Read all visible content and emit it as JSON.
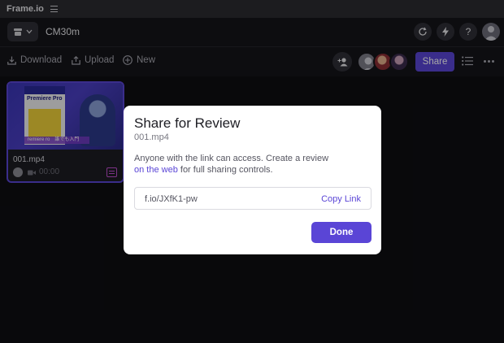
{
  "app": {
    "title": "Frame.io"
  },
  "header": {
    "project_name": "CM30m"
  },
  "toolbar": {
    "download_label": "Download",
    "upload_label": "Upload",
    "new_label": "New",
    "share_label": "Share"
  },
  "asset": {
    "filename": "001.mp4",
    "duration": "00:00",
    "thumbnail": {
      "book_title": "Premiere Pro",
      "caption": "remiere  ro　誰でも入門"
    }
  },
  "modal": {
    "title": "Share for Review",
    "subtitle": "001.mp4",
    "text_before": "Anyone with the link can access. Create a review",
    "link_text": "on the web",
    "text_after": " for full sharing controls.",
    "link_url": "f.io/JXfK1-pw",
    "copy_label": "Copy Link",
    "done_label": "Done"
  },
  "icons": {
    "menu": "hamburger-icon",
    "team": "team-icon",
    "refresh": "refresh-icon",
    "activity": "lightning-icon",
    "help": "?",
    "download": "download-icon",
    "upload": "upload-icon",
    "new": "plus-circle-icon",
    "add_user": "add-user-icon",
    "list": "list-view-icon",
    "more": "more-icon"
  },
  "colors": {
    "accent": "#5a45d6",
    "background": "#0e0e12",
    "panel": "#15151a"
  }
}
